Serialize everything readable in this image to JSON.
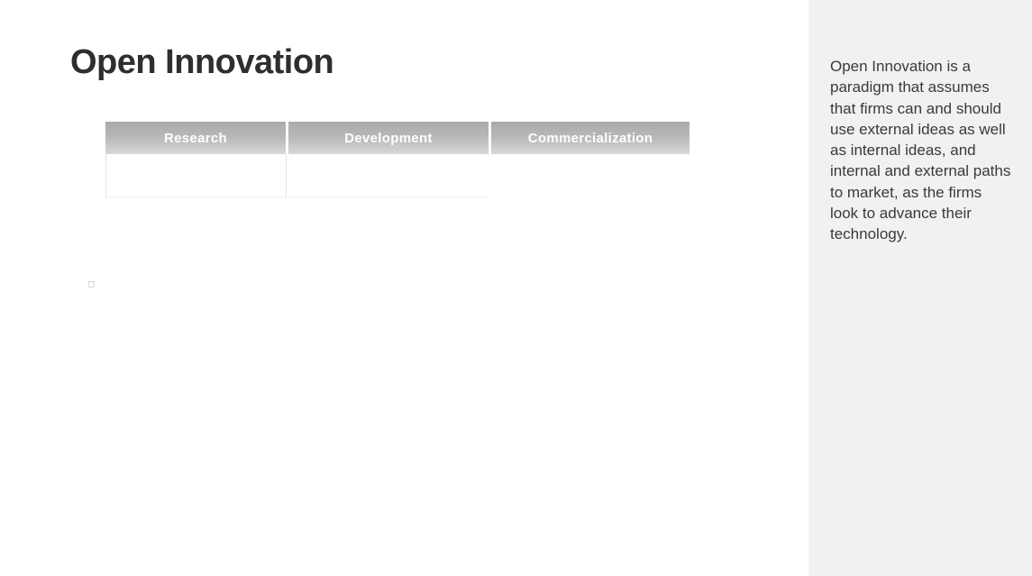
{
  "title": "Open Innovation",
  "stages": [
    {
      "label": "Research"
    },
    {
      "label": "Development"
    },
    {
      "label": "Commercialization"
    }
  ],
  "sidebar": {
    "description": "Open Innovation is a paradigm that assumes that firms can and should use external ideas as well as internal ideas, and internal and external paths to market, as the firms look to advance their technology."
  }
}
